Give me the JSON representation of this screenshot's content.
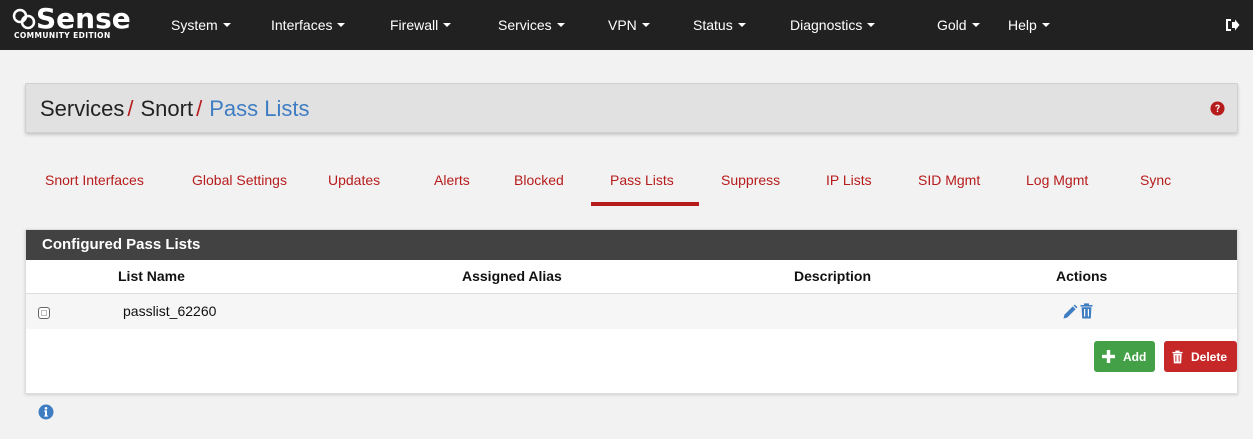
{
  "navbar": {
    "brand": {
      "logo_text": "Sense",
      "edition": "COMMUNITY EDITION"
    },
    "menu": [
      {
        "label": "System"
      },
      {
        "label": "Interfaces"
      },
      {
        "label": "Firewall"
      },
      {
        "label": "Services"
      },
      {
        "label": "VPN"
      },
      {
        "label": "Status"
      },
      {
        "label": "Diagnostics"
      },
      {
        "label": "Gold"
      },
      {
        "label": "Help"
      }
    ],
    "logout_icon": "sign-out-icon"
  },
  "breadcrumb": {
    "items": [
      "Services",
      "Snort",
      "Pass Lists"
    ],
    "separator": "/",
    "help_icon": "question-circle-icon"
  },
  "tabs": [
    {
      "label": "Snort Interfaces"
    },
    {
      "label": "Global Settings"
    },
    {
      "label": "Updates"
    },
    {
      "label": "Alerts"
    },
    {
      "label": "Blocked"
    },
    {
      "label": "Pass Lists",
      "active": true
    },
    {
      "label": "Suppress"
    },
    {
      "label": "IP Lists"
    },
    {
      "label": "SID Mgmt"
    },
    {
      "label": "Log Mgmt"
    },
    {
      "label": "Sync"
    }
  ],
  "panel": {
    "title": "Configured Pass Lists",
    "columns": [
      "List Name",
      "Assigned Alias",
      "Description",
      "Actions"
    ],
    "rows": [
      {
        "list_name": "passlist_62260",
        "assigned_alias": "",
        "description": ""
      }
    ],
    "add_label": "Add",
    "delete_label": "Delete"
  },
  "footer": {
    "info_icon": "info-circle-icon"
  },
  "colors": {
    "navbar_bg": "#212121",
    "accent_red": "#b71c1c",
    "link_blue": "#3f7dc2",
    "add_green": "#43a047",
    "delete_red": "#c62828",
    "panel_heading": "#424242"
  }
}
